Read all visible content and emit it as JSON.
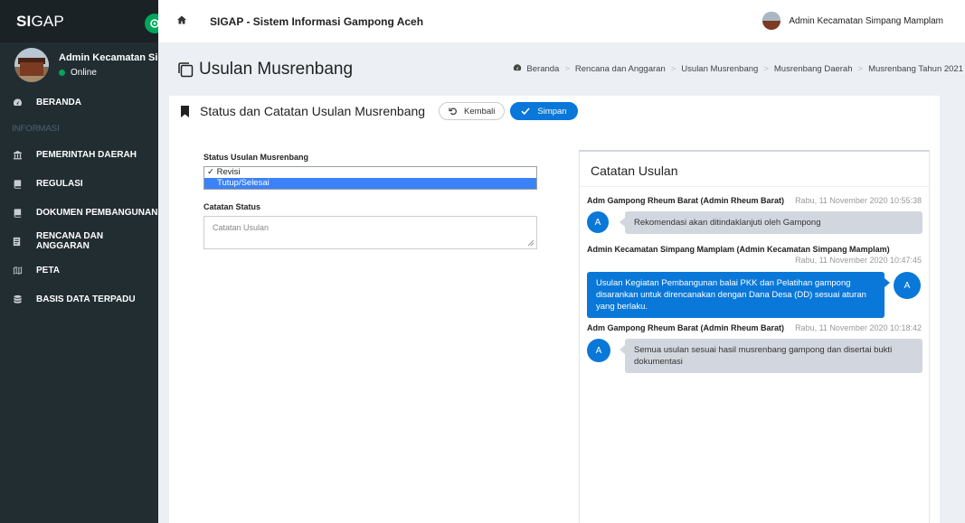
{
  "brand": {
    "bold": "SI",
    "rest": "GAP"
  },
  "user_panel": {
    "name": "Admin Kecamatan Simpang Mamplam",
    "status": "Online"
  },
  "sidebar": {
    "items": [
      {
        "label": "BERANDA",
        "icon": "dashboard-icon"
      },
      {
        "header": "INFORMASI"
      },
      {
        "label": "PEMERINTAH DAERAH",
        "icon": "institution-icon"
      },
      {
        "label": "REGULASI",
        "icon": "book-icon"
      },
      {
        "label": "DOKUMEN PEMBANGUNAN",
        "icon": "book-icon"
      },
      {
        "label": "RENCANA DAN ANGGARAN",
        "icon": "clipboard-icon"
      },
      {
        "label": "PETA",
        "icon": "map-icon"
      },
      {
        "label": "BASIS DATA TERPADU",
        "icon": "database-icon"
      }
    ]
  },
  "topbar": {
    "title": "SIGAP - Sistem Informasi Gampong Aceh",
    "user": "Admin Kecamatan Simpang Mamplam"
  },
  "page": {
    "title": "Usulan Musrenbang",
    "breadcrumb": [
      "Beranda",
      "Rencana dan Anggaran",
      "Usulan Musrenbang",
      "Musrenbang Daerah",
      "Musrenbang Tahun 2021"
    ]
  },
  "panel": {
    "title": "Status dan Catatan Usulan Musrenbang",
    "back_label": "Kembali",
    "save_label": "Simpan"
  },
  "form": {
    "status_label": "Status Usulan Musrenbang",
    "status_options": [
      {
        "text": "✓ Revisi",
        "highlighted": false
      },
      {
        "text": "Tutup/Selesai",
        "highlighted": true
      }
    ],
    "notes_label": "Catatan Status",
    "notes_placeholder": "Catatan Usulan"
  },
  "notes": {
    "title": "Catatan Usulan",
    "messages": [
      {
        "author": "Adm Gampong Rheum Barat (Admin Rheum Barat)",
        "time": "Rabu, 11 November 2020 10:55:38",
        "initial": "A",
        "side": "left",
        "text": "Rekomendasi akan ditindaklanjuti oleh Gampong"
      },
      {
        "author": "Admin Kecamatan Simpang Mamplam (Admin Kecamatan Simpang Mamplam)",
        "time": "Rabu, 11 November 2020 10:47:45",
        "initial": "A",
        "side": "right",
        "text": "Usulan Kegiatan Pembangunan balai PKK dan Pelatihan gampong disarankan untuk direncanakan dengan Dana Desa (DD) sesuai aturan yang berlaku."
      },
      {
        "author": "Adm Gampong Rheum Barat (Admin Rheum Barat)",
        "time": "Rabu, 11 November 2020 10:18:42",
        "initial": "A",
        "side": "left",
        "text": "Semua usulan sesuai hasil musrenbang gampong dan disertai bukti dokumentasi"
      }
    ]
  },
  "colors": {
    "sidebar_bg": "#222d32",
    "accent_blue": "#0a78d8",
    "online_green": "#00a65a",
    "bubble_grey": "#d2d6de"
  }
}
